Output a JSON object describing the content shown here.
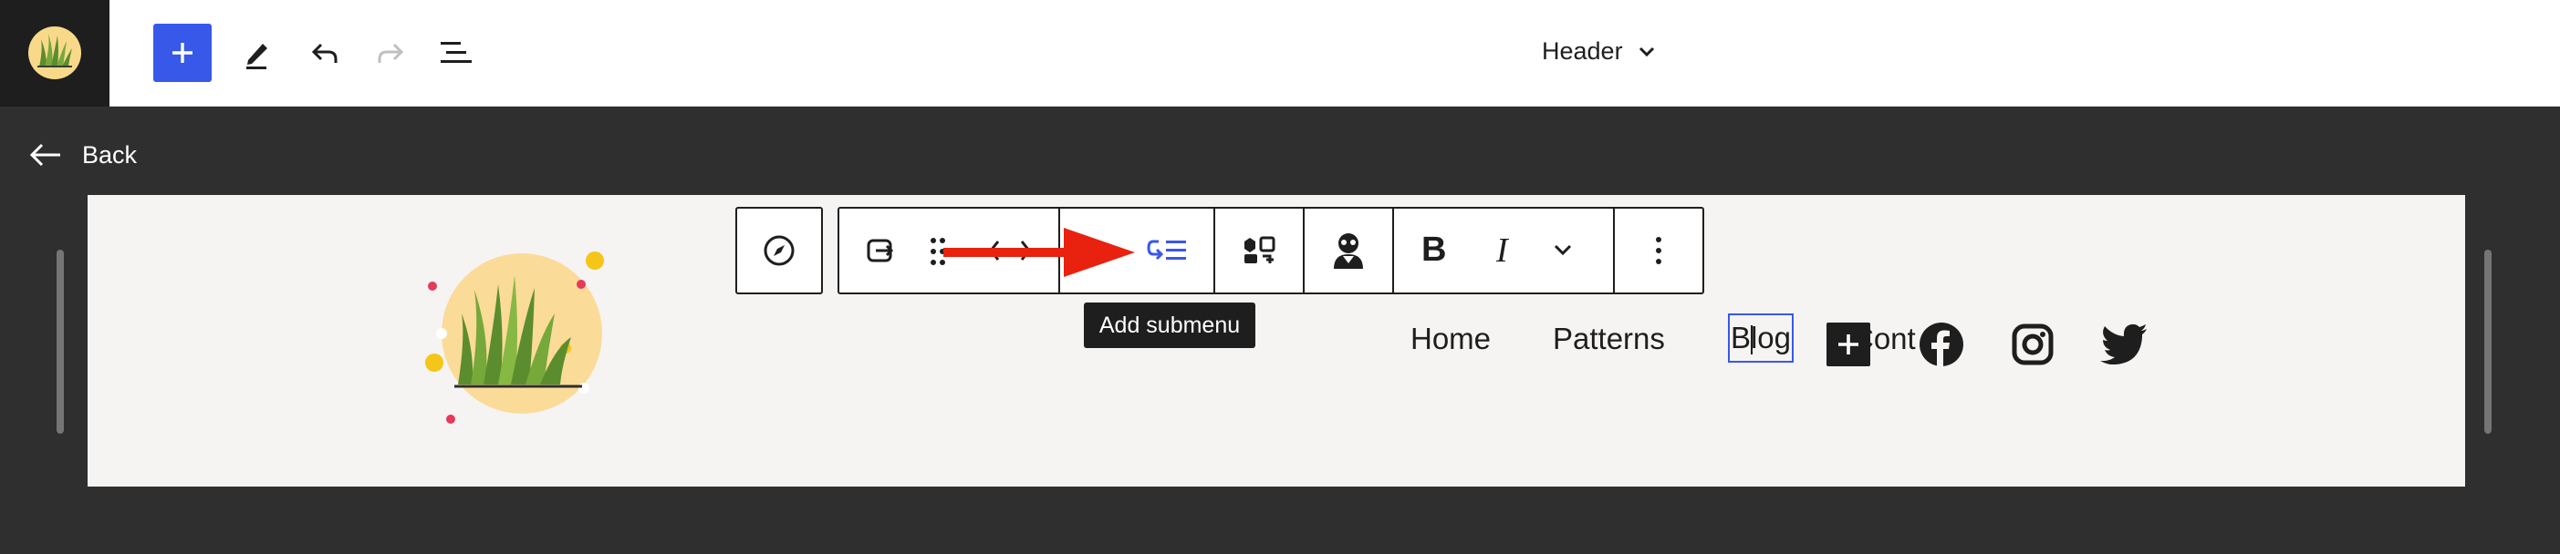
{
  "topbar": {
    "document_title": "Header",
    "icons": {
      "site": "site-logo-icon",
      "add": "plus-icon",
      "tools": "pencil-icon",
      "undo": "undo-icon",
      "redo": "redo-icon",
      "list_view": "list-view-icon",
      "title_dropdown": "chevron-down-icon"
    },
    "accent": "#3858e9"
  },
  "back": {
    "label": "Back",
    "icon": "arrow-left-icon"
  },
  "canvas": {
    "nav_items": [
      "Home",
      "Patterns",
      "Blog",
      "Cont"
    ],
    "social_links": [
      "facebook-icon",
      "instagram-icon",
      "twitter-icon"
    ],
    "appender_icon": "plus-icon",
    "background": "#f5f4f2"
  },
  "block_toolbar": {
    "parent_icon": "compass-icon",
    "groups": [
      [
        "link-icon",
        "drag-handle-icon",
        "move-arrows-icon"
      ],
      [
        "add-submenu-icon"
      ],
      [
        "transform-icon"
      ],
      [
        "avatar-icon"
      ],
      [
        "bold-icon",
        "italic-icon",
        "chevron-down-icon"
      ],
      [
        "more-options-icon"
      ]
    ],
    "bold_label": "B",
    "italic_label": "I",
    "tooltip": "Add submenu"
  },
  "annotation": {
    "type": "arrow",
    "color": "#e8220f"
  }
}
